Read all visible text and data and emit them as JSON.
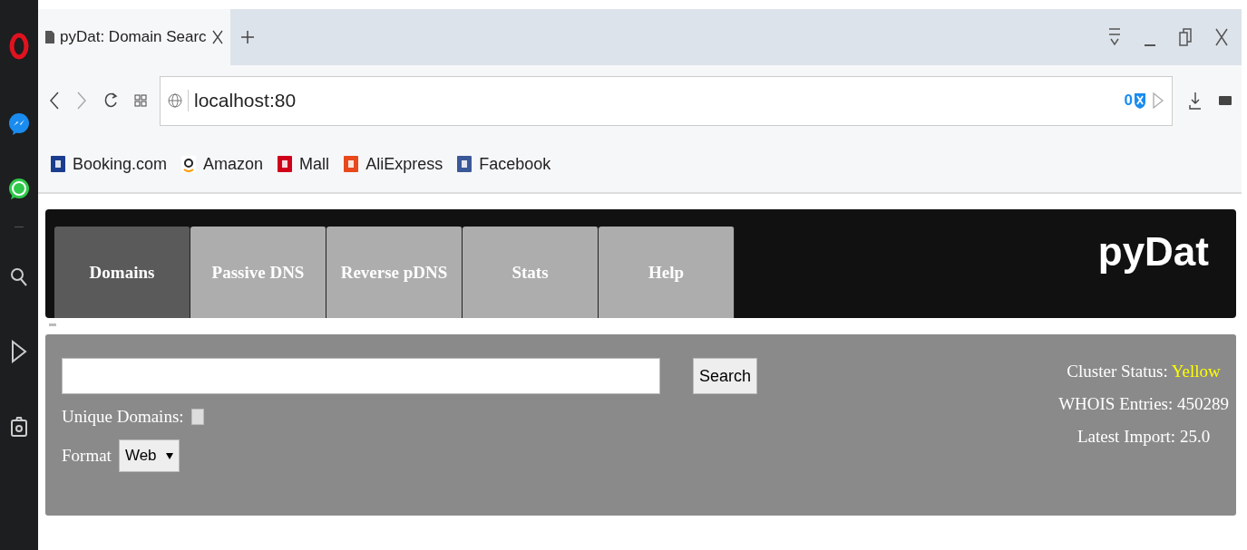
{
  "browser": {
    "tabs": [
      {
        "title": "pyDat: Domain Searc",
        "selected": true
      }
    ],
    "address_bar": {
      "url": "localhost:80",
      "badge_count": "0"
    },
    "bookmarks": [
      {
        "label": "Booking.com",
        "color": "#1b3d8f"
      },
      {
        "label": "Amazon",
        "color": "#ffffff"
      },
      {
        "label": "Mall",
        "color": "#d0021b"
      },
      {
        "label": "AliExpress",
        "color": "#e8491d"
      },
      {
        "label": "Facebook",
        "color": "#3b5998"
      }
    ]
  },
  "page": {
    "logo": "pyDat",
    "nav_tabs": [
      {
        "label": "Domains",
        "selected": true
      },
      {
        "label": "Passive DNS",
        "selected": false
      },
      {
        "label": "Reverse pDNS",
        "selected": false
      },
      {
        "label": "Stats",
        "selected": false
      },
      {
        "label": "Help",
        "selected": false
      }
    ],
    "search": {
      "button": "Search"
    },
    "unique_domains": {
      "label": "Unique Domains:",
      "checked": false
    },
    "format": {
      "label": "Format",
      "value": "Web"
    },
    "stats": {
      "cluster_status_label": "Cluster Status:",
      "cluster_status": {
        "text": "Yellow",
        "color": "#ffff00"
      },
      "whois_entries": "WHOIS Entries: 450289",
      "latest_import": "Latest Import: 25.0"
    }
  }
}
